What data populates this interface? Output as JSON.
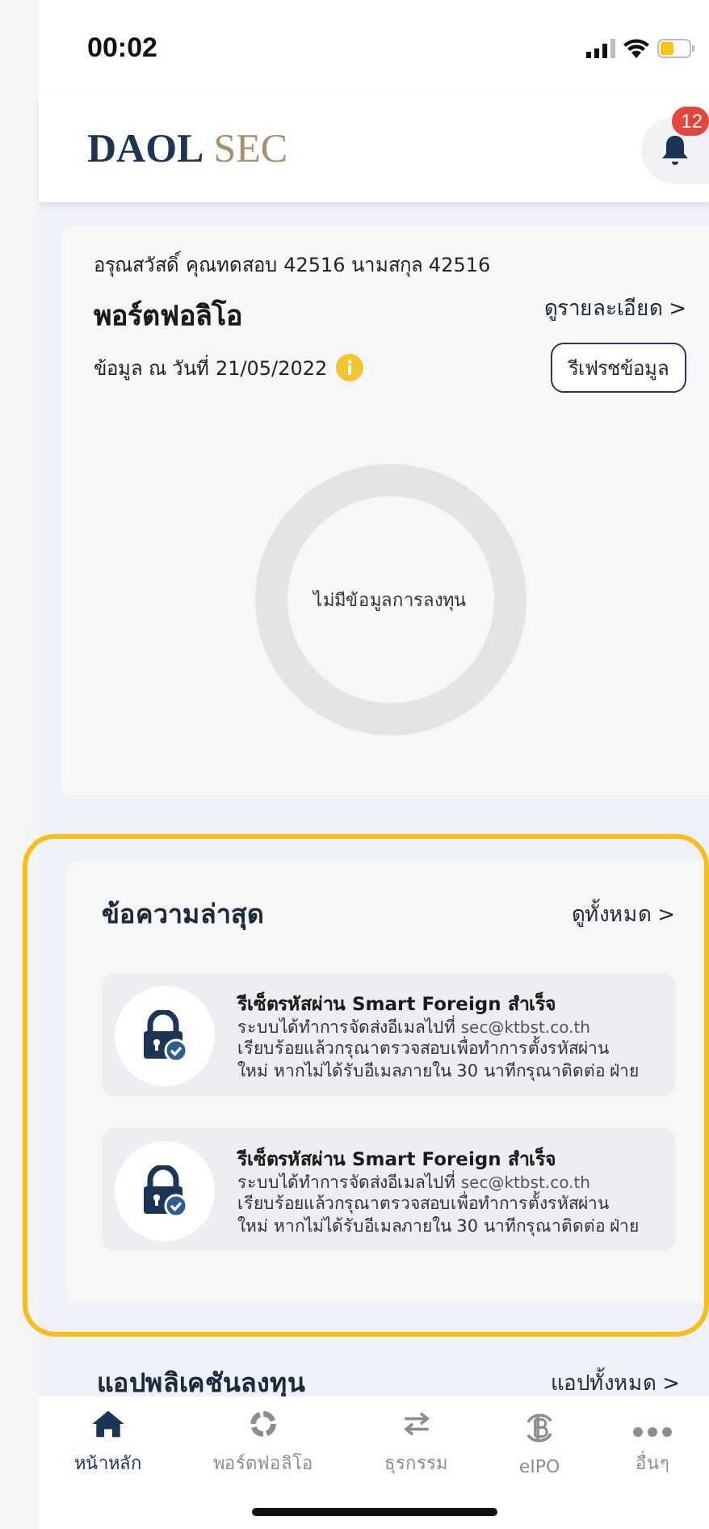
{
  "status_bar": {
    "time": "00:02"
  },
  "header": {
    "logo_primary": "DAOL",
    "logo_secondary": "SEC",
    "notification_count": "12"
  },
  "portfolio": {
    "greeting": "อรุณสวัสดิ์ คุณทดสอบ 42516 นามสกุล 42516",
    "title": "พอร์ตฟอลิโอ",
    "details_link": "ดูรายละเอียด >",
    "as_of": "ข้อมูล ณ วันที่ 21/05/2022",
    "refresh_button": "รีเฟรชข้อมูล",
    "empty_text": "ไม่มีข้อมูลการลงทุน"
  },
  "messages": {
    "title": "ข้อความล่าสุด",
    "view_all": "ดูทั้งหมด >",
    "highlighted": true,
    "items": [
      {
        "title": "รีเซ็ตรหัสผ่าน Smart Foreign สำเร็จ",
        "line1": "ระบบได้ทำการจัดส่งอีเมลไปที่",
        "email": "sec@ktbst.co.th",
        "line2": "เรียบร้อยแล้วกรุณาตรวจสอบเพื่อทำการตั้งรหัสผ่าน",
        "line3": "ใหม่ หากไม่ได้รับอีเมลภายใน 30 นาทีกรุณาติดต่อ ฝ่าย"
      },
      {
        "title": "รีเซ็ตรหัสผ่าน Smart Foreign สำเร็จ",
        "line1": "ระบบได้ทำการจัดส่งอีเมลไปที่",
        "email": "sec@ktbst.co.th",
        "line2": "เรียบร้อยแล้วกรุณาตรวจสอบเพื่อทำการตั้งรหัสผ่าน",
        "line3": "ใหม่ หากไม่ได้รับอีเมลภายใน 30 นาทีกรุณาติดต่อ ฝ่าย"
      }
    ]
  },
  "apps": {
    "title": "แอปพลิเคชันลงทุน",
    "view_all": "แอปทั้งหมด >"
  },
  "bottom_nav": [
    {
      "kind": "home",
      "label": "หน้าหลัก",
      "selected": true
    },
    {
      "kind": "portfolio",
      "label": "พอร์ตฟอลิโอ",
      "selected": false
    },
    {
      "kind": "transfer",
      "label": "ธุรกรรม",
      "selected": false
    },
    {
      "kind": "ipo",
      "label": "eIPO",
      "selected": false
    },
    {
      "kind": "more",
      "label": "อื่นๆ",
      "selected": false
    }
  ]
}
